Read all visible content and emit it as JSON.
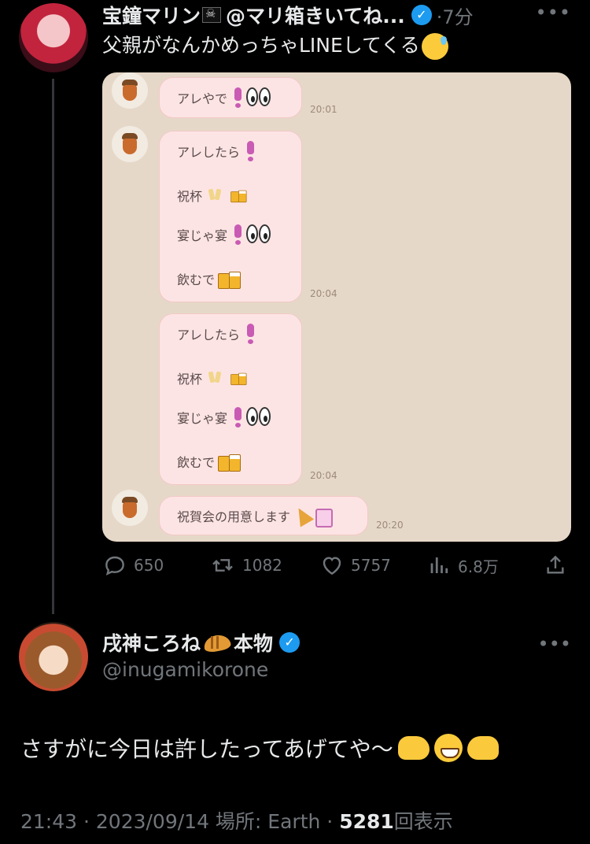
{
  "tweet": {
    "display_name": "宝鐘マリン",
    "handle": "@マリ箱きいてね...",
    "time": "·7分",
    "text": "父親がなんかめっちゃLINEしてくる",
    "stats": {
      "replies": "650",
      "retweets": "1082",
      "likes": "5757",
      "views": "6.8万"
    }
  },
  "line_chat": {
    "messages": [
      {
        "lines": [
          "アレやで"
        ],
        "time": "20:01"
      },
      {
        "lines": [
          "アレしたら",
          "祝杯",
          "宴じゃ宴",
          "飲むで"
        ],
        "time": "20:04"
      },
      {
        "lines": [
          "アレしたら",
          "祝杯",
          "宴じゃ宴",
          "飲むで"
        ],
        "time": "20:04"
      },
      {
        "lines": [
          "祝賀会の用意します"
        ],
        "time": "20:20"
      }
    ]
  },
  "reply": {
    "display_name": "戌神ころね",
    "name_suffix": "本物",
    "handle": "@inugamikorone",
    "text": "さすがに今日は許したってあげてや〜",
    "timestamp": "21:43 · 2023/09/14 場所: Earth · ",
    "views_count": "5281",
    "views_label": "回表示"
  },
  "icons": [
    "verified-badge-icon",
    "more-icon",
    "reply-icon",
    "retweet-icon",
    "like-icon",
    "views-icon",
    "share-icon"
  ],
  "colors": {
    "background": "#000000",
    "text": "#e7e9ea",
    "muted": "#71767b",
    "verified": "#1d9bf0",
    "line_bg": "#e6d8c8",
    "bubble": "#fde4e4"
  }
}
